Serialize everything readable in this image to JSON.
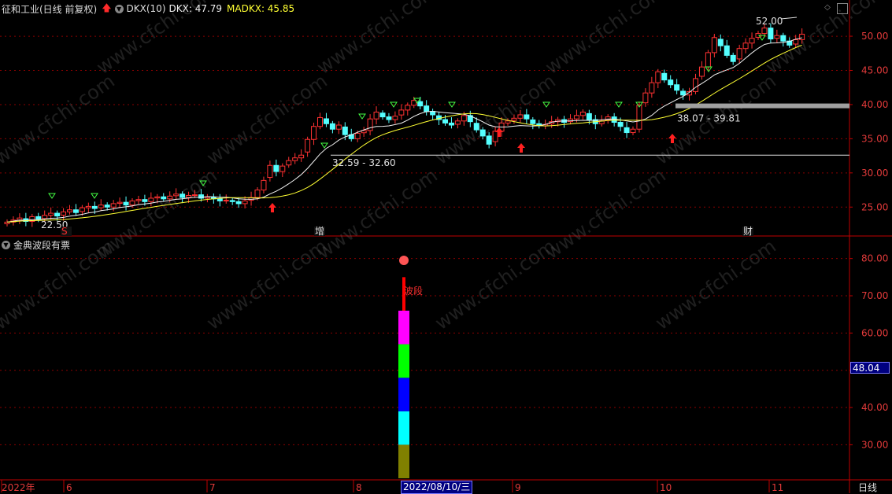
{
  "header": {
    "title": "征和工业(日线 前复权)",
    "indicator_name": "DKX(10)",
    "dkx_label": "DKX: 47.79",
    "madkx_label": "MADKX: 45.85"
  },
  "sub_panel": {
    "title": "金典波段有票",
    "bar_label": "波段",
    "cursor_value": "48.04"
  },
  "price_axis": [
    "50.00",
    "45.00",
    "40.00",
    "35.00",
    "30.00",
    "25.00"
  ],
  "sub_axis": [
    "80.00",
    "70.00",
    "60.00",
    "50.00",
    "40.00",
    "30.00"
  ],
  "date_axis": [
    "2022年",
    "6",
    "7",
    "8",
    "9",
    "10",
    "11"
  ],
  "cursor_date": "2022/08/10/三",
  "period": "日线",
  "annotations": {
    "high_label": "52.00",
    "low_label": "22.50",
    "zone1": "32.59 - 32.60",
    "zone2": "38.07 - 39.81"
  },
  "event_tags": [
    "S",
    "增",
    "财"
  ],
  "watermark": "www.cfchi.com",
  "colors": {
    "up": "#ff3232",
    "down": "#54ffff",
    "dkx": "#f2f2f2",
    "madkx": "#ffff33",
    "grid": "#8b0000",
    "axis_text": "#e23a3a"
  },
  "chart_data": [
    {
      "type": "candlestick",
      "title": "征和工业(日线 前复权)",
      "x_range": [
        "2022-05",
        "2022-11"
      ],
      "ylim": [
        21,
        53
      ],
      "grid": true,
      "price_high": 52.0,
      "price_low": 22.5,
      "support_levels": [
        32.6,
        39.81
      ],
      "ohlc_close_series": [
        22.8,
        23.1,
        23.4,
        22.9,
        23.6,
        23.2,
        23.8,
        24.1,
        23.7,
        24.3,
        24.6,
        24.2,
        24.9,
        25.1,
        24.8,
        25.3,
        25.0,
        25.5,
        25.7,
        25.3,
        25.9,
        26.1,
        25.8,
        26.3,
        26.5,
        26.2,
        26.6,
        26.9,
        26.4,
        26.7,
        26.8,
        26.3,
        26.5,
        26.2,
        25.9,
        26.0,
        25.8,
        25.5,
        25.9,
        26.4,
        27.5,
        28.9,
        31.1,
        30.2,
        31.0,
        31.8,
        32.2,
        32.6,
        34.9,
        36.8,
        38.1,
        37.2,
        36.4,
        37.0,
        35.6,
        35.0,
        35.8,
        36.2,
        37.9,
        38.9,
        38.2,
        37.8,
        38.3,
        39.2,
        39.9,
        40.6,
        39.8,
        39.0,
        38.5,
        37.8,
        37.3,
        37.0,
        37.6,
        38.4,
        37.5,
        36.3,
        35.4,
        34.2,
        36.1,
        37.3,
        37.6,
        38.0,
        38.5,
        37.9,
        37.2,
        36.9,
        37.1,
        37.5,
        37.8,
        37.4,
        37.9,
        38.4,
        38.9,
        37.8,
        37.2,
        37.6,
        38.2,
        37.4,
        36.8,
        35.9,
        36.4,
        39.9,
        41.7,
        43.2,
        44.8,
        43.6,
        42.9,
        42.1,
        41.4,
        41.9,
        43.8,
        45.5,
        47.6,
        49.8,
        48.6,
        47.2,
        46.3,
        48.2,
        49.0,
        49.7,
        50.4,
        51.2,
        49.6,
        50.1,
        49.3,
        48.7,
        49.5,
        50.3
      ],
      "dkx": 47.79,
      "madkx": 45.85
    },
    {
      "type": "bar",
      "title": "金典波段有票",
      "ylim": [
        21,
        85
      ],
      "segments": [
        {
          "color": "olive",
          "from": 21,
          "to": 30
        },
        {
          "color": "cyan",
          "from": 30,
          "to": 39
        },
        {
          "color": "blue",
          "from": 39,
          "to": 48
        },
        {
          "color": "green",
          "from": 48,
          "to": 57
        },
        {
          "color": "magenta",
          "from": 57,
          "to": 66
        },
        {
          "color": "red",
          "from": 66,
          "to": 75
        }
      ]
    }
  ]
}
